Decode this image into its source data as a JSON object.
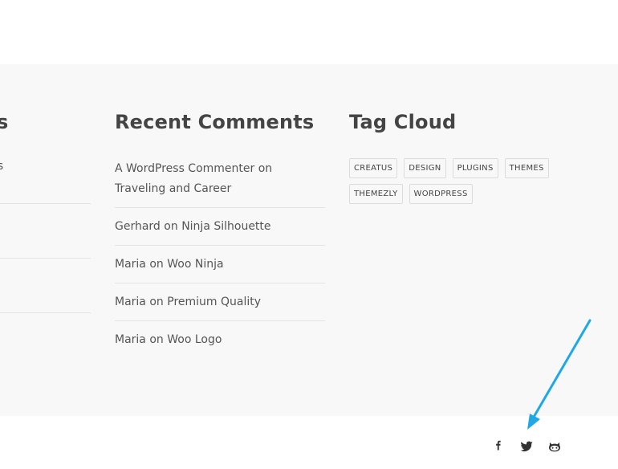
{
  "widgets": {
    "left": {
      "title_fragment": "s",
      "text_fragment": "ps"
    },
    "recent_comments": {
      "title": "Recent Comments",
      "items": [
        {
          "author": "A WordPress Commenter",
          "on": "on",
          "post": "Traveling and Career"
        },
        {
          "author": "Gerhard",
          "on": "on",
          "post": "Ninja Silhouette"
        },
        {
          "author": "Maria",
          "on": "on",
          "post": "Woo Ninja"
        },
        {
          "author": "Maria",
          "on": "on",
          "post": "Premium Quality"
        },
        {
          "author": "Maria",
          "on": "on",
          "post": "Woo Logo"
        }
      ]
    },
    "tag_cloud": {
      "title": "Tag Cloud",
      "tags": [
        "CREATUS",
        "DESIGN",
        "PLUGINS",
        "THEMES",
        "THEMEZLY",
        "WORDPRESS"
      ]
    }
  },
  "footer": {
    "social": [
      {
        "icon": "facebook-icon"
      },
      {
        "icon": "twitter-icon"
      },
      {
        "icon": "github-icon"
      }
    ]
  },
  "colors": {
    "widget_bg": "#f8f8f8",
    "heading": "#444444",
    "text": "#555555",
    "arrow": "#1ea8e6"
  }
}
